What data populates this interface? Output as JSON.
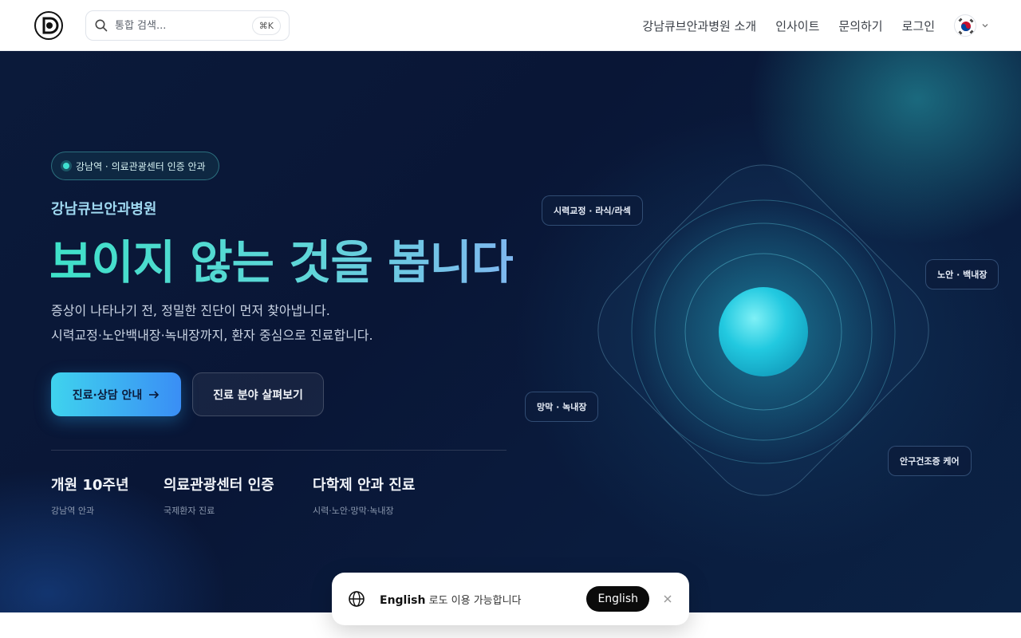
{
  "header": {
    "search_placeholder": "통합 검색...",
    "search_shortcut": "⌘K",
    "nav": [
      "강남큐브안과병원 소개",
      "인사이트",
      "문의하기",
      "로그인"
    ]
  },
  "hero": {
    "badge": "강남역 · 의료관광센터 인증 안과",
    "hospital_name": "강남큐브안과병원",
    "headline": "보이지 않는 것을 봅니다",
    "desc_line1": "증상이 나타나기 전, 정밀한 진단이 먼저 찾아냅니다.",
    "desc_line2": "시력교정·노안백내장·녹내장까지, 환자 중심으로 진료합니다.",
    "primary_button": "진료·상담 안내",
    "secondary_button": "진료 분야 살펴보기",
    "stats": [
      {
        "title": "개원 10주년",
        "sub": "강남역 안과"
      },
      {
        "title": "의료관광센터 인증",
        "sub": "국제환자 진료"
      },
      {
        "title": "다학제 안과 진료",
        "sub": "시력·노안·망막·녹내장"
      }
    ],
    "diagram_labels": [
      "시력교정 · 라식/라섹",
      "노안 · 백내장",
      "망막 · 녹내장",
      "안구건조증 케어"
    ]
  },
  "toast": {
    "language_name": "English",
    "message_suffix": "로도 이용 가능합니다",
    "button": "English"
  },
  "colors": {
    "accent_teal": "#3ee0c8",
    "accent_blue": "#3a8ef5",
    "hero_bg": "#0b1a3a"
  },
  "icons": [
    "logo-icon",
    "search-icon",
    "korea-flag-icon",
    "chevron-down-icon",
    "arrow-right-icon",
    "globe-icon",
    "close-icon"
  ]
}
